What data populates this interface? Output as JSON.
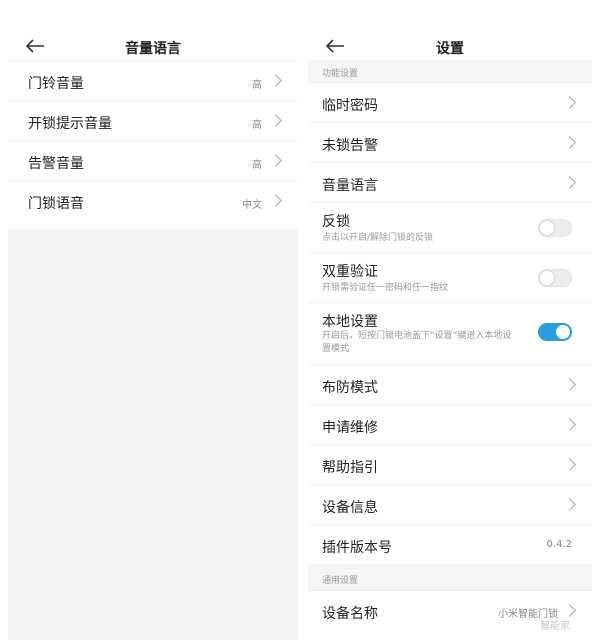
{
  "left_screen": {
    "title": "音量语言",
    "items": [
      {
        "label": "门铃音量",
        "value": "高"
      },
      {
        "label": "开锁提示音量",
        "value": "高"
      },
      {
        "label": "告警音量",
        "value": "高"
      },
      {
        "label": "门锁语音",
        "value": "中文"
      }
    ]
  },
  "right_screen": {
    "title": "设置",
    "section_function": "功能设置",
    "temp_password": "临时密码",
    "unlocked_alarm": "未锁告警",
    "volume_language": "音量语言",
    "anti_lock": {
      "label": "反锁",
      "desc": "点击以开启/解除门锁的反锁",
      "on": false
    },
    "dual_verify": {
      "label": "双重验证",
      "desc": "开锁需验证任一密码和任一指纹",
      "on": false
    },
    "local_settings": {
      "label": "本地设置",
      "desc": "开启后，短按门锁电池盖下“设置”键进入本地设置模式",
      "on": true
    },
    "arming_mode": "布防模式",
    "repair_request": "申请维修",
    "help_guide": "帮助指引",
    "device_info": "设备信息",
    "plugin_version": {
      "label": "插件版本号",
      "value": "0.4.2"
    },
    "section_general": "通用设置",
    "device_name": {
      "label": "设备名称",
      "value": "小米智能门锁"
    }
  },
  "watermark": "智能家",
  "colors": {
    "accent": "#2a9be0",
    "background_gray": "#f3f3f3",
    "secondary_text": "#999999"
  }
}
